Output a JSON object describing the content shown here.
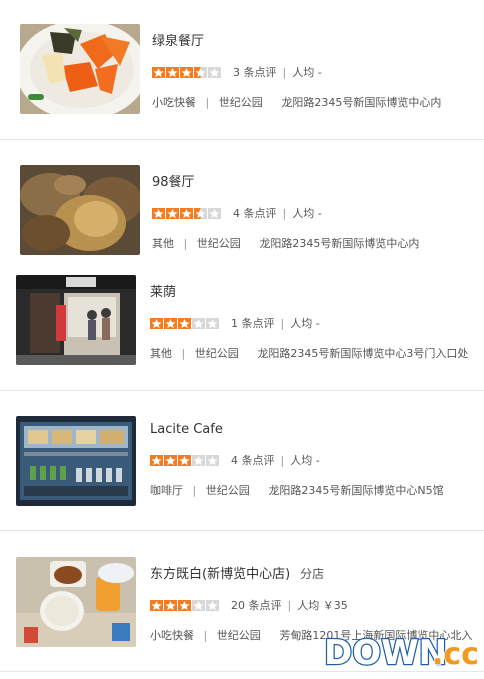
{
  "colors": {
    "star_on": "#f47b20",
    "star_off": "#d8d8d8",
    "divider": "#e6e6e6"
  },
  "restaurants": [
    {
      "name": "绿泉餐厅",
      "branch": "",
      "stars": 3.5,
      "reviews": "3 条点评",
      "avg": "人均 -",
      "category": "小吃快餐",
      "area": "世纪公园",
      "address": "龙阳路2345号新国际博览中心内",
      "image_icon": "food-plate-photo"
    },
    {
      "name": "98餐厅",
      "branch": "",
      "stars": 3.5,
      "reviews": "4 条点评",
      "avg": "人均 -",
      "category": "其他",
      "area": "世纪公园",
      "address": "龙阳路2345号新国际博览中心内",
      "image_icon": "food-dish-photo"
    },
    {
      "name": "莱荫",
      "branch": "",
      "stars": 3,
      "reviews": "1 条点评",
      "avg": "人均 -",
      "category": "其他",
      "area": "世纪公园",
      "address": "龙阳路2345号新国际博览中心3号门入口处",
      "image_icon": "storefront-photo"
    },
    {
      "name": "Lacite Cafe",
      "branch": "",
      "stars": 3,
      "reviews": "4 条点评",
      "avg": "人均 -",
      "category": "咖啡厅",
      "area": "世纪公园",
      "address": "龙阳路2345号新国际博览中心N5馆",
      "image_icon": "display-fridge-photo"
    },
    {
      "name": "东方既白(新博览中心店)",
      "branch": "分店",
      "stars": 3,
      "reviews": "20 条点评",
      "avg": "人均 ￥35",
      "category": "小吃快餐",
      "area": "世纪公园",
      "address": "芳甸路1201号上海新国际博览中心北入",
      "image_icon": "meal-tray-photo"
    }
  ],
  "watermark": {
    "text_a": "DOWN",
    "text_b": ".cc"
  }
}
